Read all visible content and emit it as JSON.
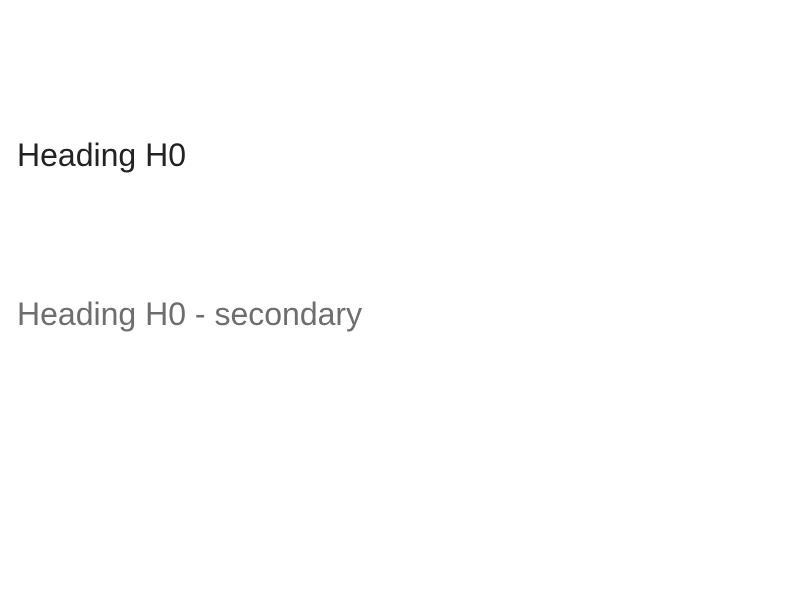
{
  "headings": {
    "primary": "Heading H0",
    "secondary": "Heading H0 - secondary"
  },
  "colors": {
    "primary_text": "#222222",
    "secondary_text": "#6e6e6e",
    "background": "#ffffff"
  }
}
